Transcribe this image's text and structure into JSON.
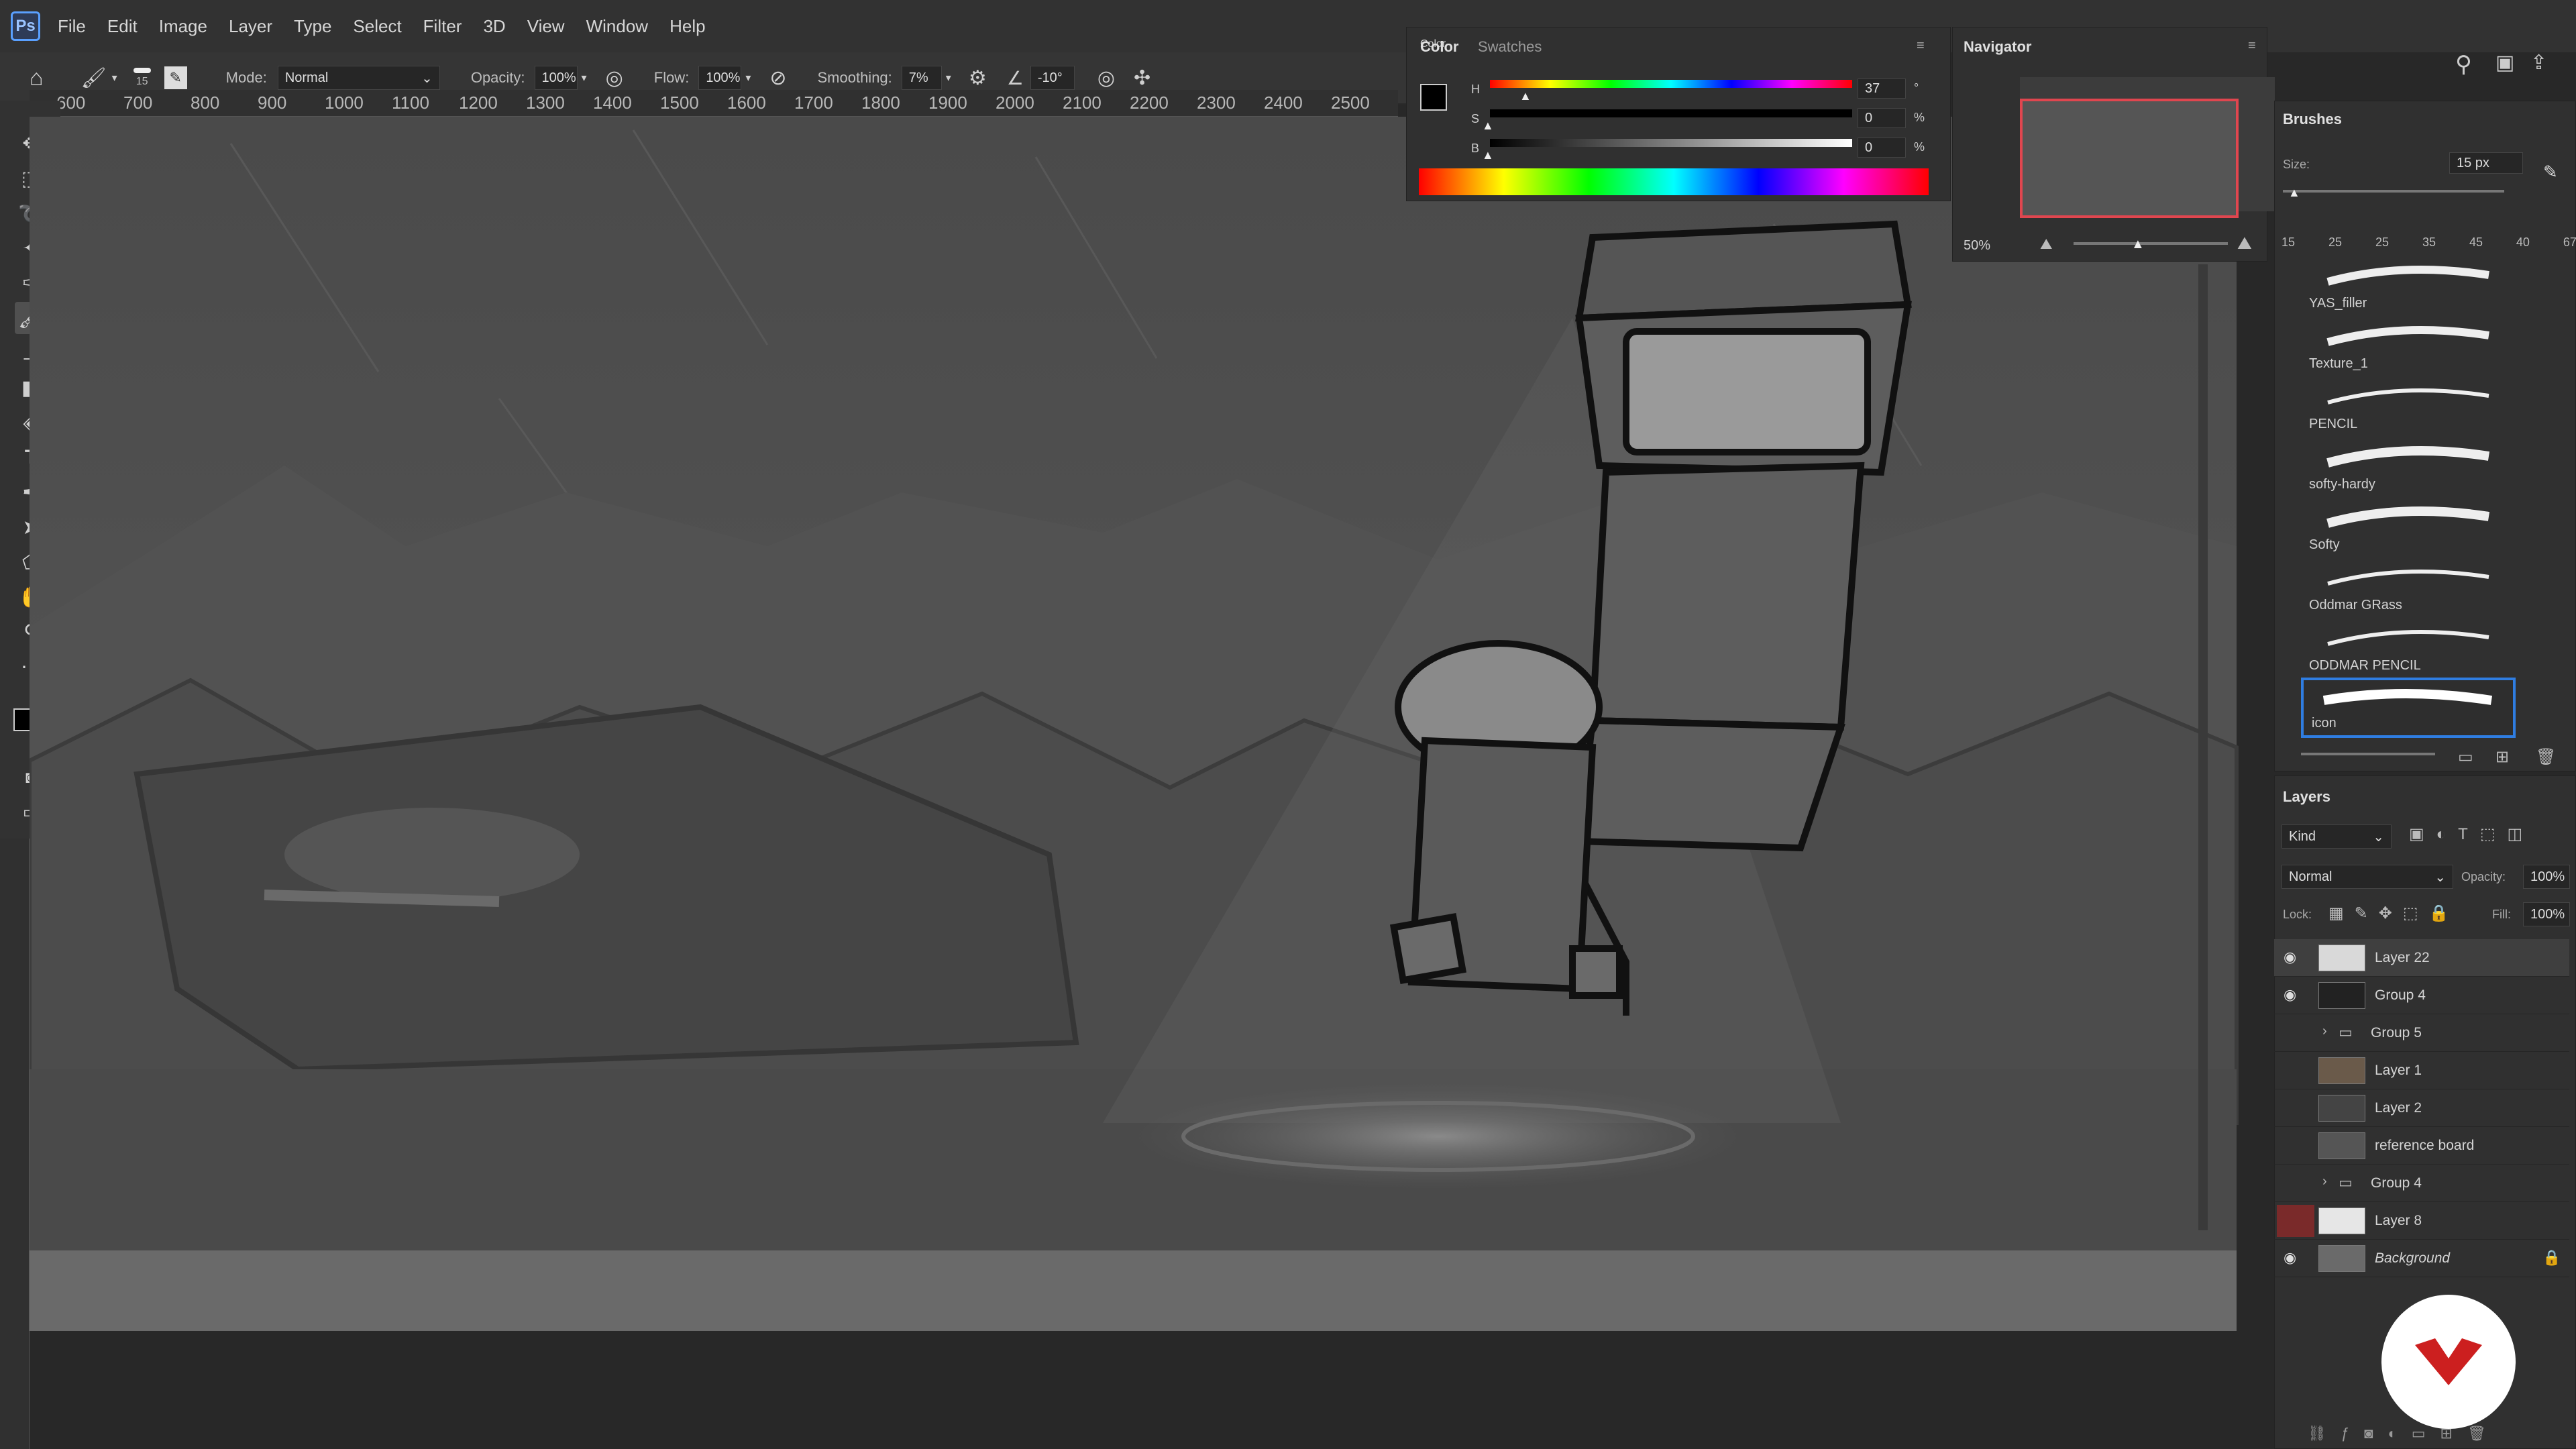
{
  "menubar": {
    "logo": "Ps",
    "items": [
      "File",
      "Edit",
      "Image",
      "Layer",
      "Type",
      "Select",
      "Filter",
      "3D",
      "View",
      "Window",
      "Help"
    ]
  },
  "options": {
    "brush_size": "15",
    "mode_label": "Mode:",
    "mode_value": "Normal",
    "opacity_label": "Opacity:",
    "opacity_value": "100%",
    "flow_label": "Flow:",
    "flow_value": "100%",
    "smoothing_label": "Smoothing:",
    "smoothing_value": "7%",
    "angle_value": "-10°"
  },
  "ruler": {
    "ticks": [
      "600",
      "700",
      "800",
      "900",
      "1000",
      "1100",
      "1200",
      "1300",
      "1400",
      "1500",
      "1600",
      "1700",
      "1800",
      "1900",
      "2000",
      "2100",
      "2200",
      "2300",
      "2400",
      "2500"
    ]
  },
  "color_panel": {
    "tab_active": "Color",
    "tab_inactive": "Swatches",
    "h_label": "H",
    "s_label": "S",
    "b_label": "B",
    "h_value": "37",
    "s_value": "0",
    "b_value": "0",
    "h_unit": "°",
    "s_unit": "%",
    "b_unit": "%"
  },
  "navigator": {
    "title": "Navigator",
    "zoom": "50%"
  },
  "brushes": {
    "title": "Brushes",
    "size_label": "Size:",
    "size_value": "15 px",
    "preset_sizes": [
      "15",
      "25",
      "25",
      "35",
      "45",
      "40",
      "67"
    ],
    "items": [
      "YAS_filler",
      "Texture_1",
      "PENCIL",
      "softy-hardy",
      "Softy",
      "Oddmar GRass",
      "ODDMAR PENCIL",
      "icon"
    ]
  },
  "layers": {
    "title": "Layers",
    "kind": "Kind",
    "blend": "Normal",
    "opacity_label": "Opacity:",
    "opacity_value": "100%",
    "lock_label": "Lock:",
    "fill_label": "Fill:",
    "fill_value": "100%",
    "rows": [
      {
        "name": "Layer 22",
        "visible": true,
        "selected": true
      },
      {
        "name": "Group 4",
        "visible": true,
        "selected": false
      },
      {
        "name": "Group 5",
        "visible": false,
        "selected": false
      },
      {
        "name": "Layer 1",
        "visible": false,
        "selected": false
      },
      {
        "name": "Layer 2",
        "visible": false,
        "selected": false
      },
      {
        "name": "reference board",
        "visible": false,
        "selected": false
      },
      {
        "name": "Group 4",
        "visible": false,
        "selected": false
      },
      {
        "name": "Layer 8",
        "visible": false,
        "selected": false
      },
      {
        "name": "Background",
        "visible": true,
        "selected": false
      }
    ]
  },
  "colors": {
    "accent": "#2f7de1",
    "selected_row": "#3f3f3f",
    "badge_red": "#cc1f1f"
  }
}
